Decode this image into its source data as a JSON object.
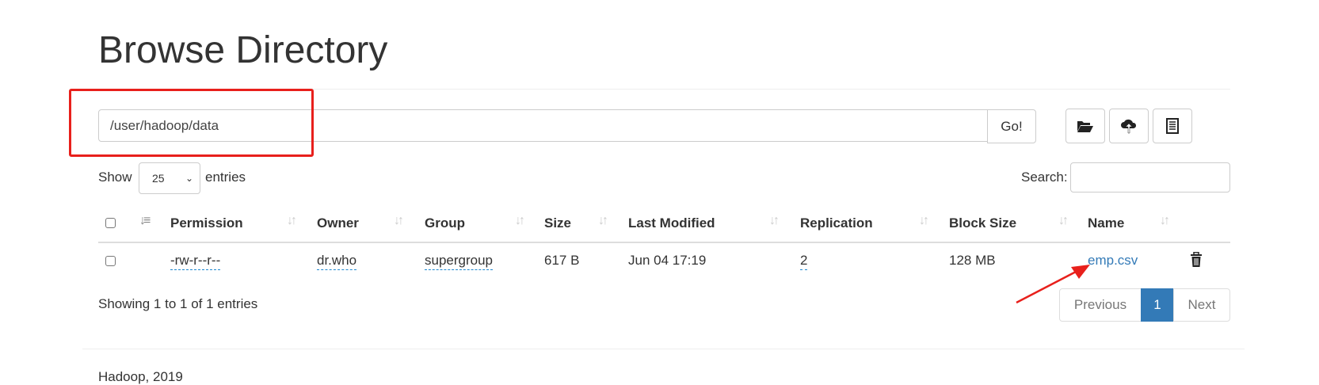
{
  "page_title": "Browse Directory",
  "path_input": {
    "value": "/user/hadoop/data"
  },
  "go_button": "Go!",
  "toolbar": {
    "icons": [
      "folder-open-icon",
      "cloud-upload-icon",
      "list-alt-icon"
    ]
  },
  "length": {
    "show": "Show",
    "value": "25",
    "entries": "entries"
  },
  "search": {
    "label": "Search:",
    "value": ""
  },
  "table": {
    "headers": [
      "Permission",
      "Owner",
      "Group",
      "Size",
      "Last Modified",
      "Replication",
      "Block Size",
      "Name"
    ],
    "rows": [
      {
        "permission": "-rw-r--r--",
        "owner": "dr.who",
        "group": "supergroup",
        "size": "617 B",
        "last_modified": "Jun 04 17:19",
        "replication": "2",
        "block_size": "128 MB",
        "name": "emp.csv"
      }
    ]
  },
  "info": "Showing 1 to 1 of 1 entries",
  "pagination": {
    "previous": "Previous",
    "current": "1",
    "next": "Next"
  },
  "footer": "Hadoop, 2019",
  "colors": {
    "annotation": "#e8201c",
    "link": "#337ab7",
    "active_page": "#337ab7"
  }
}
